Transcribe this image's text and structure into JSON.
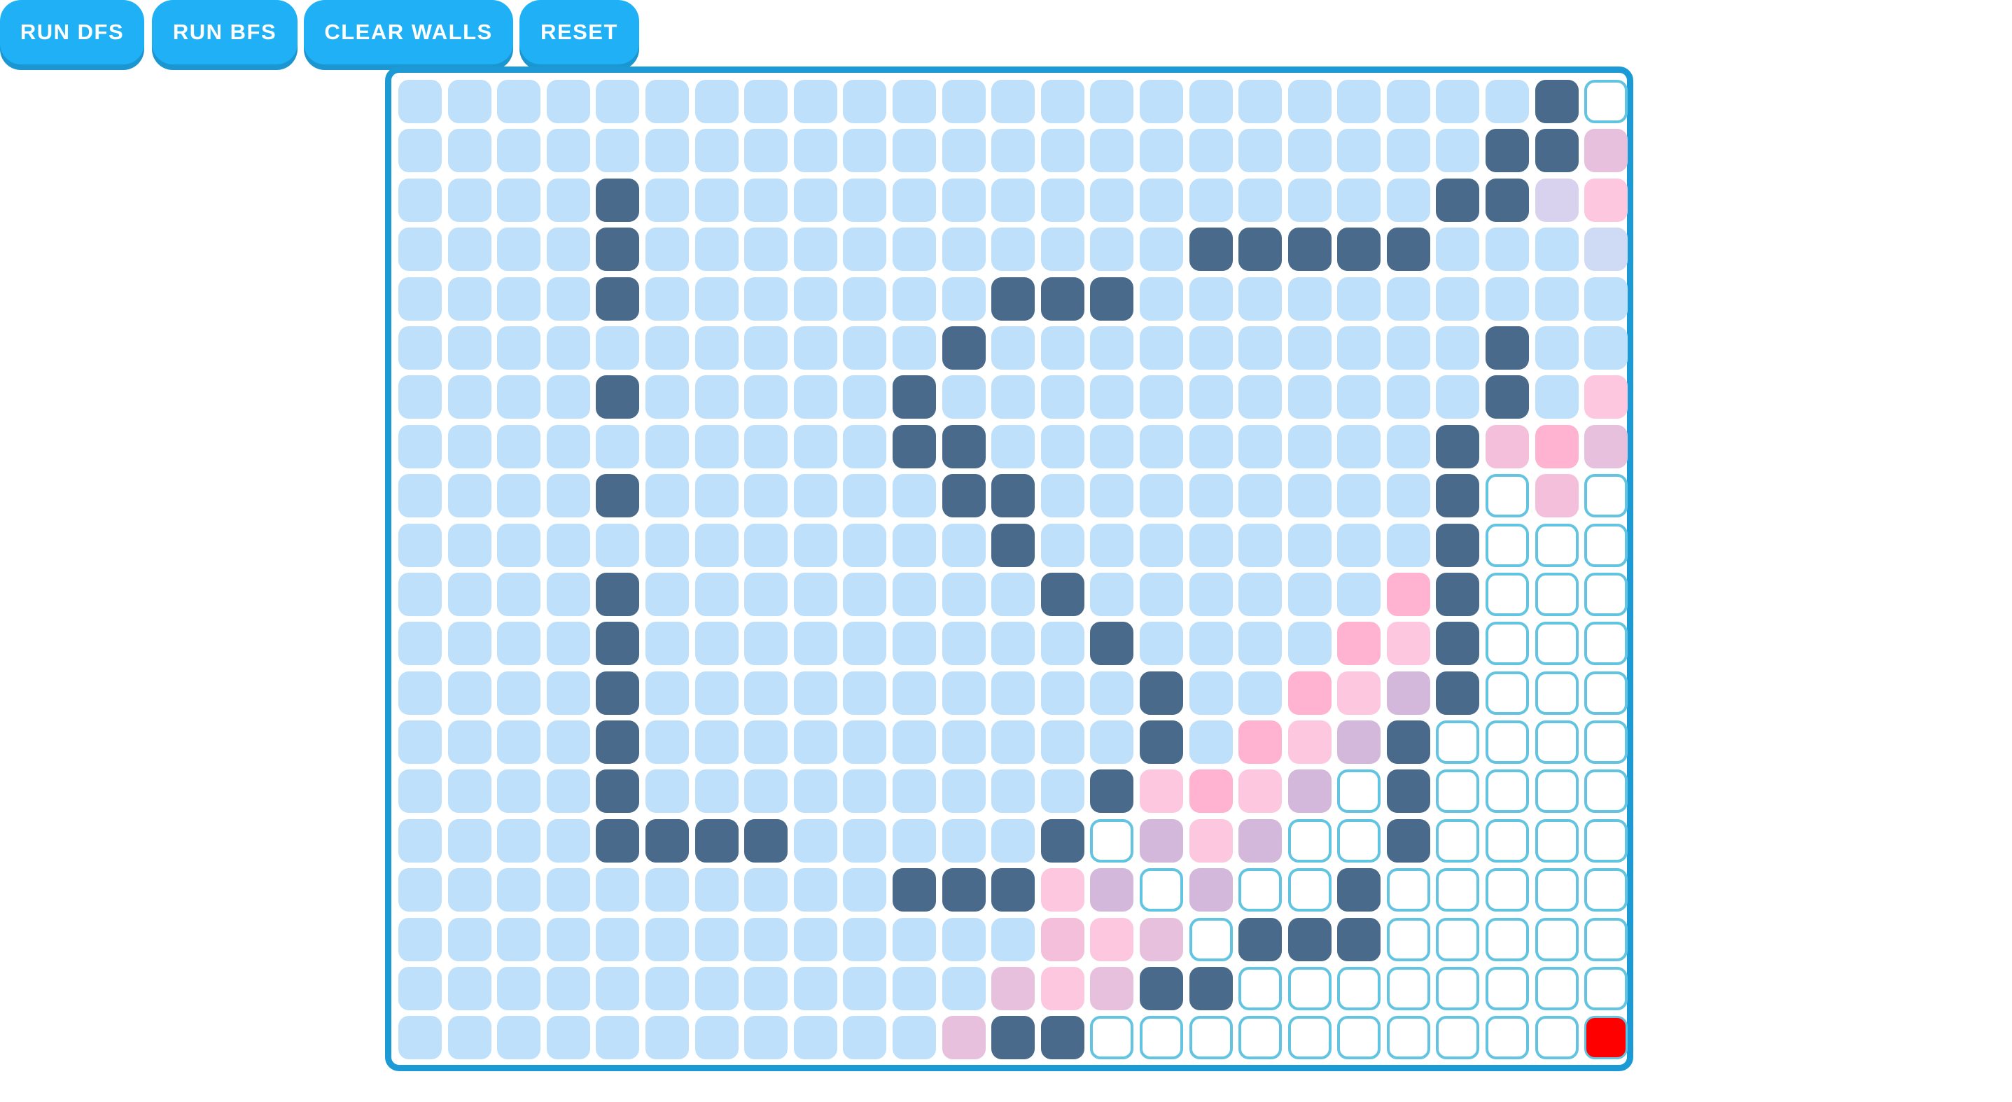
{
  "toolbar": {
    "run_dfs_label": "RUN DFS",
    "run_bfs_label": "RUN BFS",
    "clear_walls_label": "CLEAR WALLS",
    "reset_label": "RESET"
  },
  "grid": {
    "columns": 25,
    "rows_count": 20,
    "legend": {
      "b": "visited",
      "w": "wall",
      "e": "unvisited",
      "r": "target",
      "p1": "frontier-strong",
      "p2": "frontier-light",
      "p3": "frontier-mauve",
      "p4": "frontier-pink-purple",
      "p5": "frontier-lavender",
      "p6": "frontier-blue-lavender",
      "p7": "frontier-rose"
    },
    "colors": {
      "b": "#bee0fb",
      "w": "#496a8a",
      "e": "#ffffff",
      "outline": "#62c4e0",
      "r": "#ff0000",
      "p1": "#ffb3d0",
      "p2": "#fdc7df",
      "p3": "#d3b8dc",
      "p4": "#e6c0dd",
      "p5": "#d8d2ef",
      "p6": "#cfdaf5",
      "p7": "#f4bfdb",
      "accent": "#1fb0f5",
      "border": "#1b9ad6"
    },
    "rows": [
      "b b b b b b b b b b b b b b b b b b b b b b b w e",
      "b b b b b b b b b b b b b b b b b b b b b b w w p4",
      "b b b b w b b b b b b b b b b b b b b b b w w p5 p2",
      "b b b b w b b b b b b b b b b b w w w w w b b b p6",
      "b b b b w b b b b b b b w w w b b b b b b b b b b",
      "b b b b b b b b b b b w b b b b b b b b b b w b b",
      "b b b b w b b b b b w b b b b b b b b b b b w b p2",
      "b b b b b b b b b b w w b b b b b b b b b w p7 p1 p4",
      "b b b b w b b b b b b w w b b b b b b b b w e p7 e",
      "b b b b b b b b b b b b w b b b b b b b b w e e e",
      "b b b b w b b b b b b b b w b b b b b b p1 w e e e",
      "b b b b w b b b b b b b b b w b b b b p1 p2 w e e e",
      "b b b b w b b b b b b b b b b w b b p1 p2 p3 w e e e",
      "b b b b w b b b b b b b b b b w b p1 p2 p3 w e e e e",
      "b b b b w b b b b b b b b b w p2 p1 p2 p3 e w e e e e",
      "b b b b w w w w b b b b b w e p3 p2 p3 e e w e e e e",
      "b b b b b b b b b b w w w p2 p3 e p3 e e w e e e e e",
      "b b b b b b b b b b b b b p7 p2 p4 e w w w e e e e e",
      "b b b b b b b b b b b b p4 p2 p4 w w e e e e e e e e",
      "b b b b b b b b b b b p4 w w e e e e e e e e e e r"
    ]
  }
}
